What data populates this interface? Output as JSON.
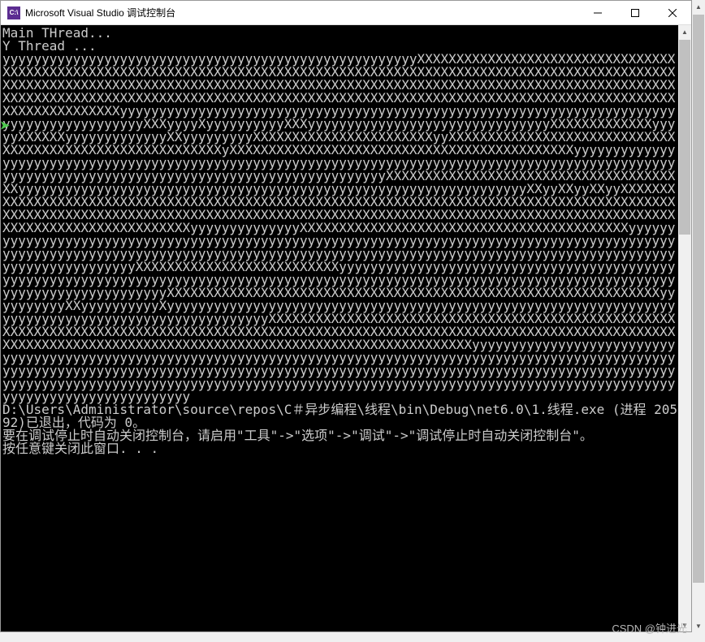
{
  "titlebar": {
    "icon_text": "C:\\",
    "title": "Microsoft Visual Studio 调试控制台"
  },
  "console_lines": [
    "Main THread...",
    "Y Thread ...",
    "yyyyyyyyyyyyyyyyyyyyyyyyyyyyyyyyyyyyyyyyyyyyyyyyyyyyyXXXXXXXXXXXXXXXXXXXXXXXXXXXXXXXXXXXXXXXXXXXXXXXXXXXXXXXXXXXXXXXXXXXXXXXXXXXXXXXXXXXXXXXXXXXXXXXXXXXXXXXXXXXXXXXXXXXXXXXXXXXXXXXXXXXXXXXXXXXXXXXXXXXXXXXXXXXXXXXXXXXXXXXXXXXXXXXXXXXXXXXXXXXXXXXXXXXXXXXXXXXXXXXXXXXXXXXXXXXXXXXXXXXXXXXXXXXXXXXXXXXXXXXXXXXXXXXXXXXXXXXXXXXXXXXXXXXXXXXXXXXXXXXXXXXXXXXXXXXXXXXXXXyyyyyyyyyyyyyyyyyyyyyyyyyyyyyyyyyyyyyyyyyyyyyyyyyyyyyyyyyyyyyyyyyyyyyyyyyyyyyyyyyyyyyyyyyXXXyyyyXyyyyyyyyyyXXXyyyyyyyyyyyyyyyyyyyyyyyyyyyyyyyXXXXXXXXXXXXXyyyyyXXXXXXyyyyyyyyyyyyyXXyyyyyyyyyXXXXXXXXXXXXXXXXXXXXXXXyyXXXXXXXXXXXXXXXXXXXXXXXXXXXXXXXXXXXXXXXXXXXXXXXXXXXXXXXXXyXXXXXXXXXXXXXXXXXXXXXXXXXXXXXXXXXXXXXXXXXXXXyyyyyyyyyyyyyyyyyyyyyyyyyyyyyyyyyyyyyyyyyyyyyyyyyyyyyyyyyyyyyyyyyyyyyyyyyyyyyyyyyyyyyyyyyyyyyyyyyyyyyyyyyyyyyyyyyyyyyyyyyyyyyyyyyyyyyyyyyyyyyyyyyyyyXXXXXXXXXXXXXXXXXXXXXXXXXXXXXXXXXXXXXXXyyyyyyyyyyyyyyyyyyyyyyyyyyyyyyyyyyyyyyyyyyyyyyyyyyyyyyyyyyyyyyyyyXXyyXXyyXXyyXXXXXXXXXXXXXXXXXXXXXXXXXXXXXXXXXXXXXXXXXXXXXXXXXXXXXXXXXXXXXXXXXXXXXXXXXXXXXXXXXXXXXXXXXXXXXXXXXXXXXXXXXXXXXXXXXXXXXXXXXXXXXXXXXXXXXXXXXXXXXXXXXXXXXXXXXXXXXXXXXXXXXXXXXXXXXXXXXXXXXXXXXXXXXXXXXXXXXXXXXXXyyyyyyyyyyyyyyXXXXXXXXXXXXXXXXXXXXXXXXXXXXXXXXXXXXXXXXXXyyyyyyyyyyyyyyyyyyyyyyyyyyyyyyyyyyyyyyyyyyyyyyyyyyyyyyyyyyyyyyyyyyyyyyyyyyyyyyyyyyyyyyyyyyyyyyyyyyyyyyyyyyyyyyyyyyyyyyyyyyyyyyyyyyyyyyyyyyyyyyyyyyyyyyyyyyyyyyyyyyyyyyyyyyyyyyyyyyyyyyyyyyyyyyyyyyyXXXXXXXXXXXXXXXXXXXXXXXXXXyyyyyyyyyyyyyyyyyyyyyyyyyyyyyyyyyyyyyyyyyyyyyyyyyyyyyyyyyyyyyyyyyyyyyyyyyyyyyyyyyyyyyyyyyyyyyyyyyyyyyyyyyyyyyyyyyyyyyyyyyyyyyyyyyyyyyyyyyyyyyyyyyyyyyyXXXXXXXXXXXXXXXXXXXXXXXXXXXXXXXXXXXXXXXXXXXXXXXXXXXXXXXXXXXXXXXyyyyyyyyyyXXyyyyyyyyyyXyyyyyyyyyyyyyyyyyyyyyyyyyyyyyyyyyyyyyyyyyyyyyyyyyyyyyyyyyyyyyyyyyyyyyyyyyyyyyyyyyyyyyyyyyyyyyyyyyyyXXXXXXXXXXXXXXXXXXXXXXXXXXXXXXXXXXXXXXXXXXXXXXXXXXXXXXXXXXXXXXXXXXXXXXXXXXXXXXXXXXXXXXXXXXXXXXXXXXXXXXXXXXXXXXXXXXXXXXXXXXXXXXXXXXXXXXXXXXXXXXXXXXXXXXXXXXXXXXXXXXXXXXXXXXXXXXXXXXXXXXXXXXXXXXXXXXXXXXyyyyyyyyyyyyyyyyyyyyyyyyyyyyyyyyyyyyyyyyyyyyyyyyyyyyyyyyyyyyyyyyyyyyyyyyyyyyyyyyyyyyyyyyyyyyyyyyyyyyyyyyyyyyyyyyyyyyyyyyyyyyyyyyyyyyyyyyyyyyyyyyyyyyyyyyyyyyyyyyyyyyyyyyyyyyyyyyyyyyyyyyyyyyyyyyyyyyyyyyyyyyyyyyyyyyyyyyyyyyyyyyyyyyyyyyyyyyyyyyyyyyyyyyyyyyyyyyyyyyyyyyyyyyyyyyyyyyyyyyyyyyyyyyyyyyyyyyyyyyyyyyyyyy",
    "D:\\Users\\Administrator\\source\\repos\\C＃异步编程\\线程\\bin\\Debug\\net6.0\\1.线程.exe (进程 20592)已退出，代码为 0。",
    "要在调试停止时自动关闭控制台，请启用\"工具\"->\"选项\"->\"调试\"->\"调试停止时自动关闭控制台\"。",
    "按任意键关闭此窗口. . ."
  ],
  "watermark": "CSDN @钟进光"
}
